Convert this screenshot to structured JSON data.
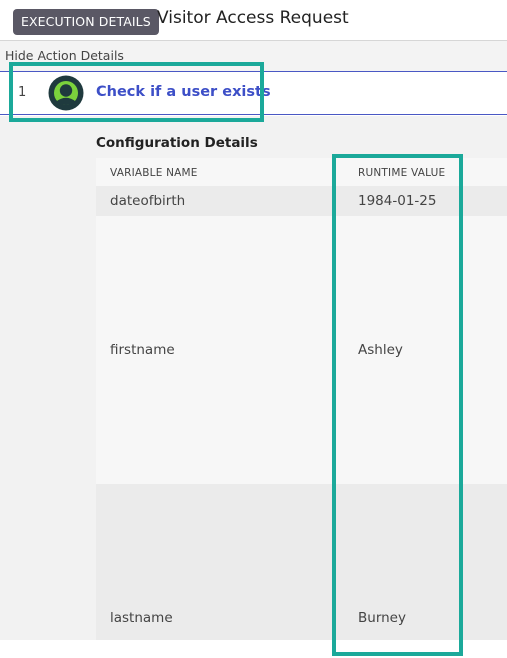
{
  "header": {
    "badge_label": "EXECUTION DETAILS",
    "title": "Visitor Access Request"
  },
  "subbar": {
    "toggle_label": "Hide Action Details"
  },
  "action": {
    "index": "1",
    "name": "Check if a user exists",
    "icon": "user-lookup-icon"
  },
  "config": {
    "title": "Configuration Details",
    "headers": {
      "variable_name": "VARIABLE NAME",
      "runtime_value": "RUNTIME VALUE"
    },
    "rows": [
      {
        "name": "dateofbirth",
        "value": "1984-01-25"
      },
      {
        "name": "firstname",
        "value": "Ashley"
      },
      {
        "name": "lastname",
        "value": "Burney"
      }
    ]
  },
  "colors": {
    "badge_bg": "#5a5865",
    "action_link": "#3d4fc7",
    "row_divider": "#4a58c4",
    "highlight": "#1ba99a",
    "icon_green": "#7bd23c",
    "icon_dark": "#1f3a3e"
  }
}
